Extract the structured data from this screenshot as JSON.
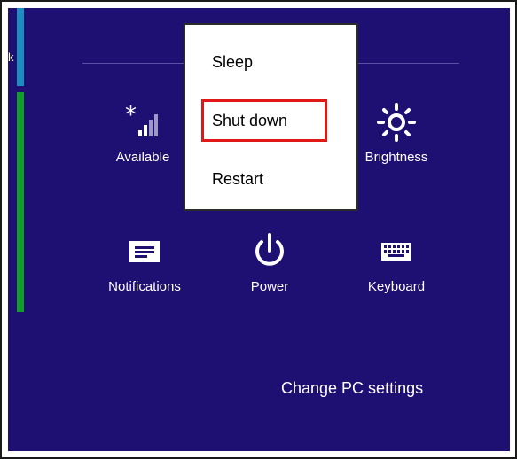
{
  "sidebar": {
    "edge_text": "k"
  },
  "settings": {
    "tiles_top": [
      {
        "label": "Available",
        "icon": "wifi-signal-icon"
      },
      {
        "label": "Brightness",
        "icon": "brightness-icon"
      }
    ],
    "tiles_bottom": [
      {
        "label": "Notifications",
        "icon": "notifications-icon"
      },
      {
        "label": "Power",
        "icon": "power-icon"
      },
      {
        "label": "Keyboard",
        "icon": "keyboard-icon"
      }
    ],
    "change_pc_settings": "Change PC settings"
  },
  "power_menu": {
    "items": [
      "Sleep",
      "Shut down",
      "Restart"
    ],
    "highlighted": "Shut down",
    "highlight_color": "#e01818"
  },
  "colors": {
    "background": "#1e0f72",
    "accent_green": "#0e9f29",
    "accent_blue": "#1a8fbf"
  }
}
